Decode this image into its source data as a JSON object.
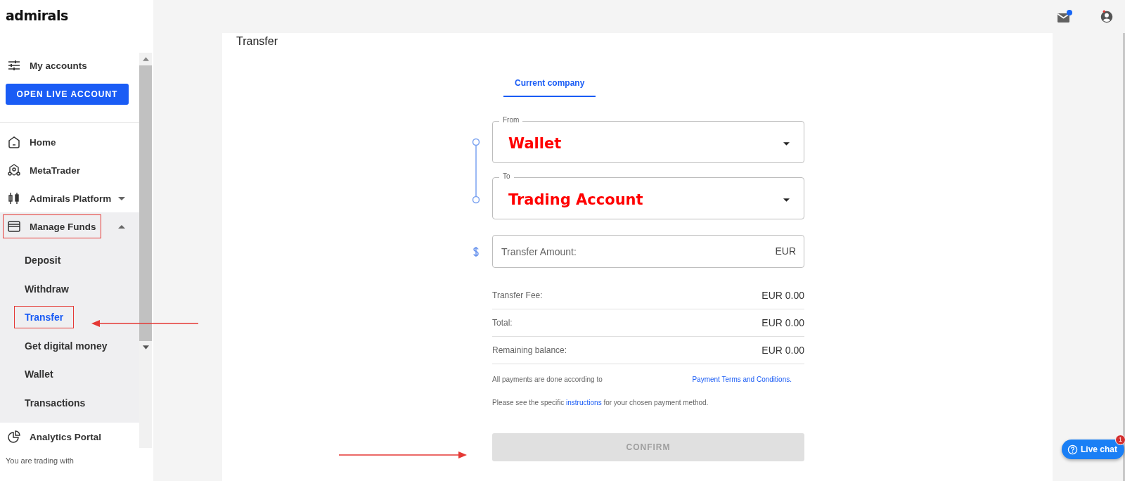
{
  "logo": "admirals",
  "sidebar": {
    "accounts_label": "My accounts",
    "open_button": "OPEN LIVE ACCOUNT",
    "nav": [
      {
        "label": "Home",
        "highlighted": false
      },
      {
        "label": "MetaTrader",
        "highlighted": false
      },
      {
        "label": "Admirals Platform",
        "highlighted": false,
        "expanded": false
      },
      {
        "label": "Manage Funds",
        "highlighted": true,
        "expanded": true,
        "children": [
          {
            "label": "Deposit",
            "selected": false,
            "highlighted": false
          },
          {
            "label": "Withdraw",
            "selected": false,
            "highlighted": false
          },
          {
            "label": "Transfer",
            "selected": true,
            "highlighted": true
          },
          {
            "label": "Get digital money",
            "selected": false,
            "highlighted": false
          },
          {
            "label": "Wallet",
            "selected": false,
            "highlighted": false
          },
          {
            "label": "Transactions",
            "selected": false,
            "highlighted": false
          }
        ]
      },
      {
        "label": "Analytics Portal",
        "highlighted": false
      }
    ],
    "footer": "You are trading with"
  },
  "page": {
    "title": "Transfer",
    "tabs": [
      {
        "label": "Current company",
        "selected": true
      }
    ],
    "from": {
      "label": "From",
      "value": "Wallet"
    },
    "to": {
      "label": "To",
      "value": "Trading Account"
    },
    "amount": {
      "placeholder": "Transfer Amount:",
      "currency": "EUR"
    },
    "summary": [
      {
        "label": "Transfer Fee:",
        "value": "EUR 0.00"
      },
      {
        "label": "Total:",
        "value": "EUR 0.00"
      },
      {
        "label": "Remaining balance:",
        "value": "EUR 0.00"
      }
    ],
    "terms": {
      "text": "All payments are done according to",
      "link": "Payment Terms and Conditions."
    },
    "instructions": {
      "before": "Please see the specific",
      "link": "instructions",
      "after": "for your chosen payment method."
    },
    "confirm": {
      "label": "CONFIRM",
      "disabled": true
    }
  },
  "live_chat": {
    "label": "Live chat",
    "badge": "1"
  }
}
